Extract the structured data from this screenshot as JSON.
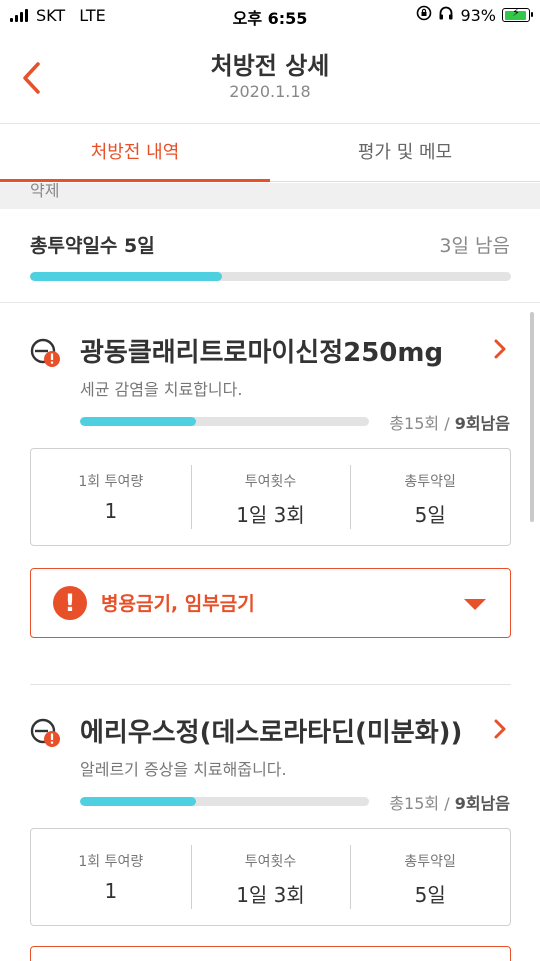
{
  "status": {
    "carrier": "SKT",
    "network": "LTE",
    "time": "오후 6:55",
    "battery_percent": "93%",
    "battery_level": 0.93,
    "icons": [
      "rotation-lock-icon",
      "headphones-icon"
    ]
  },
  "header": {
    "title": "처방전 상세",
    "date": "2020.1.18"
  },
  "tabs": [
    {
      "label": "처방전 내역",
      "active": true
    },
    {
      "label": "평가 및 메모",
      "active": false
    }
  ],
  "partial_text": "약제",
  "summary": {
    "label": "총투약일수 5일",
    "remaining": "3일 남음",
    "progress": 0.4
  },
  "drugs": [
    {
      "name": "광동클래리트로마이신정250mg",
      "description": "세균 감염을 치료합니다.",
      "count_total": "총15회",
      "count_sep": " / ",
      "count_remaining": "9회남음",
      "progress": 0.4,
      "stats": [
        {
          "label": "1회 투여량",
          "value": "1"
        },
        {
          "label": "투여횟수",
          "value": "1일 3회"
        },
        {
          "label": "총투약일",
          "value": "5일"
        }
      ],
      "warning": "병용금기, 임부금기"
    },
    {
      "name": "에리우스정(데스로라타딘(미분화))",
      "description": "알레르기 증상을 치료해줍니다.",
      "count_total": "총15회",
      "count_sep": " / ",
      "count_remaining": "9회남음",
      "progress": 0.4,
      "stats": [
        {
          "label": "1회 투여량",
          "value": "1"
        },
        {
          "label": "투여횟수",
          "value": "1일 3회"
        },
        {
          "label": "총투약일",
          "value": "5일"
        }
      ]
    }
  ],
  "colors": {
    "accent": "#e8502a",
    "progress": "#4ed0e0",
    "battery": "#32c94a"
  }
}
